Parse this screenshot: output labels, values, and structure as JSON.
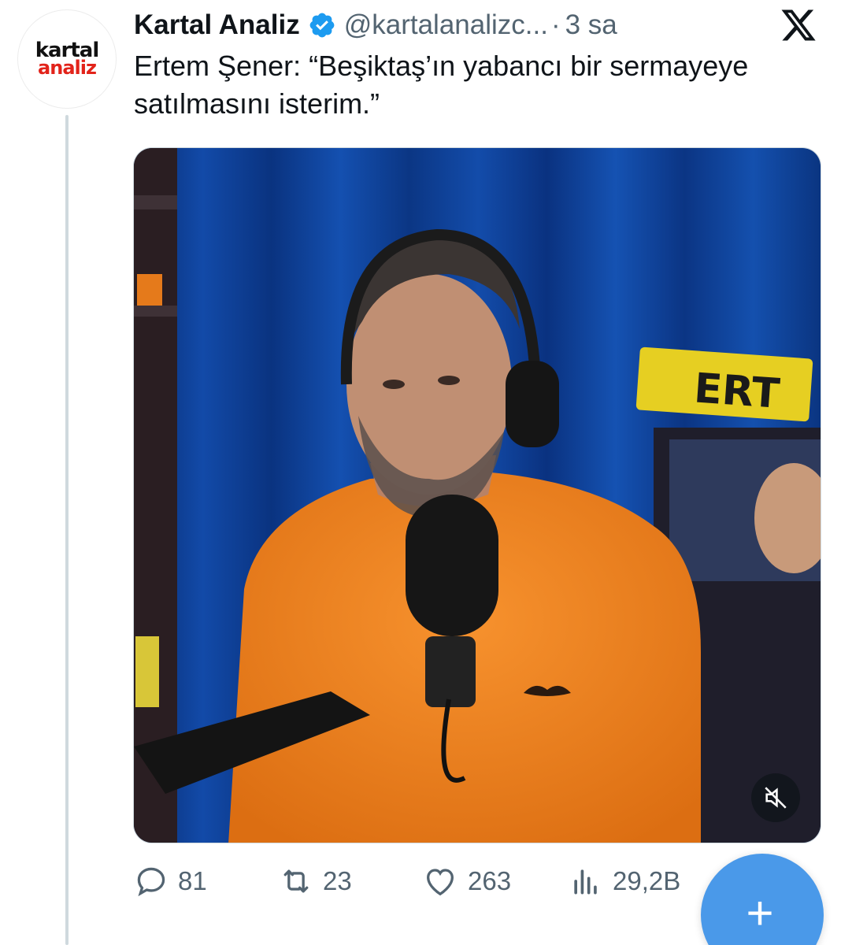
{
  "avatar": {
    "logo_top": "kartal",
    "logo_bottom": "analiz"
  },
  "author": {
    "name": "Kartal Analiz",
    "handle": "@kartalanalizc...",
    "separator": "·",
    "time": "3 sa",
    "verified": true
  },
  "tweet": {
    "text": "Ertem Şener: “Beşiktaş’ın yabancı bir sermayeye satılmasını isterim.”"
  },
  "media": {
    "sign_text": "ERT",
    "muted_icon": "speaker-muted-icon"
  },
  "actions": {
    "replies": "81",
    "retweets": "23",
    "likes": "263",
    "views": "29,2B"
  },
  "fab": {
    "label": "+"
  },
  "colors": {
    "accent": "#4a99e9",
    "verified": "#1d9bf0",
    "text_secondary": "#536471",
    "logo_red": "#e2231a",
    "curtain_blue": "#0c3a8a",
    "shirt_orange": "#f0821e"
  }
}
